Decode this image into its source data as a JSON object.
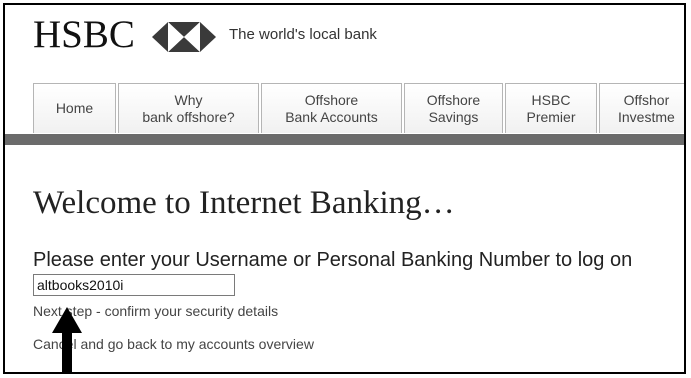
{
  "header": {
    "logo": "HSBC",
    "logo_icon": "hsbc-hexagon-icon",
    "tagline": "The world's local bank"
  },
  "nav": {
    "tabs": [
      {
        "line1": "Home",
        "line2": ""
      },
      {
        "line1": "Why",
        "line2": "bank offshore?"
      },
      {
        "line1": "Offshore",
        "line2": "Bank Accounts"
      },
      {
        "line1": "Offshore",
        "line2": "Savings"
      },
      {
        "line1": "HSBC",
        "line2": "Premier"
      },
      {
        "line1": "Offshor",
        "line2": "Investme"
      }
    ]
  },
  "main": {
    "title": "Welcome to Internet Banking…",
    "prompt": "Please enter your Username or Personal Banking Number to log on",
    "username_value": "altbooks2010i",
    "next_step_link": "Next step - confirm your security details",
    "cancel_link": "Cancel and go back to my accounts overview"
  },
  "annotation": {
    "arrow_icon": "up-arrow-icon"
  },
  "colors": {
    "nav_bar": "#6b6b6b",
    "tab_border": "#b5b5b5",
    "text": "#222222"
  }
}
